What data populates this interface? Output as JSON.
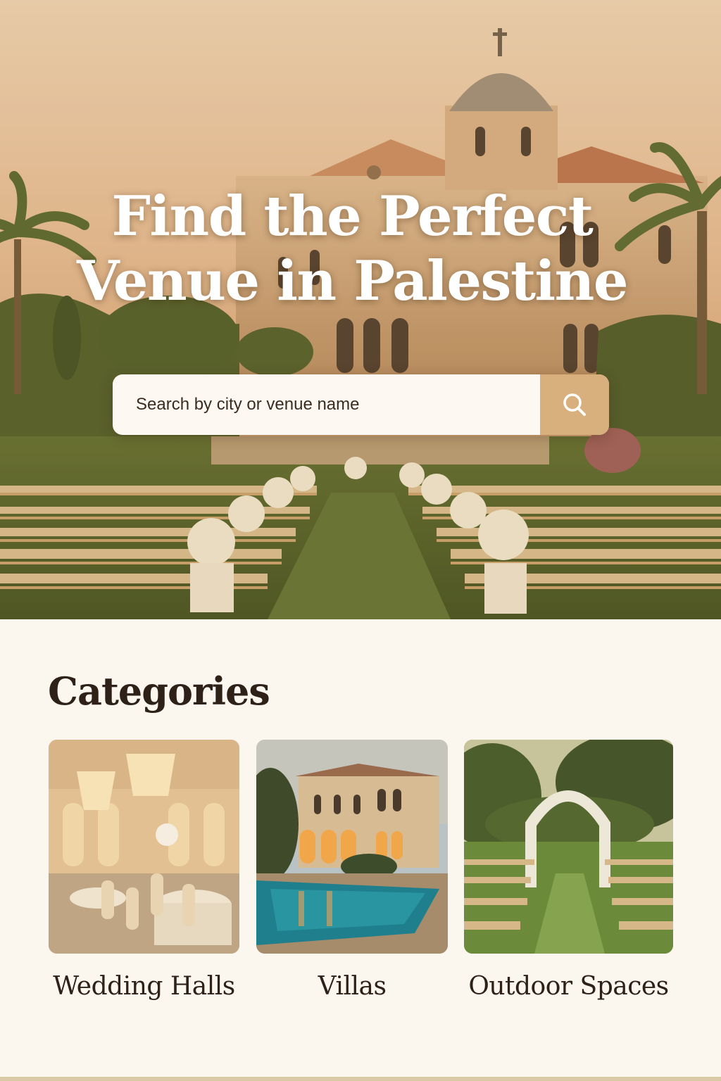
{
  "hero": {
    "title_line1": "Find the Perfect",
    "title_line2": "Venue in Palestine",
    "search_placeholder": "Search by city or venue name",
    "search_icon": "search-icon"
  },
  "categories": {
    "title": "Categories",
    "items": [
      {
        "label": "Wedding Halls",
        "image": "banquet-hall-with-chandeliers"
      },
      {
        "label": "Villas",
        "image": "stone-villa-with-pool"
      },
      {
        "label": "Outdoor Spaces",
        "image": "floral-arch-garden-ceremony"
      }
    ]
  },
  "colors": {
    "background": "#fbf6ee",
    "search_button": "#d8b07e",
    "title_text": "#2d2118"
  }
}
